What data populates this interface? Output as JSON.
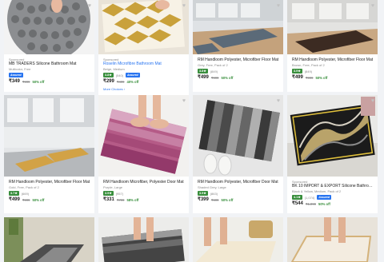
{
  "colors": {
    "accent": "#2874f0",
    "rating": "#388e3c",
    "background": "#f1f3f6"
  },
  "icons": {
    "wishlist": "heart-icon",
    "assured": "flipkart-assured-badge"
  },
  "products": [
    {
      "sponsored": "Sponsored",
      "title": "MB TRADERS Silicone Bathroom Mat",
      "variant": "Multicolor, Free",
      "rating": "",
      "count": "",
      "assured": "Assured",
      "price": "₹349",
      "mrp": "₹999",
      "off": "50% off",
      "more": ""
    },
    {
      "sponsored": "Sponsored",
      "title": "Roselin Microfibre Bathroom Mat",
      "variant": "Beige, Medium",
      "rating": "3.8★",
      "count": "(540)",
      "assured": "Assured",
      "price": "₹299",
      "mrp": "₹499",
      "off": "40% off",
      "more": "More Choices ›"
    },
    {
      "sponsored": "",
      "title": "RM Handloom Polyester, Microfiber Floor Mat",
      "variant": "Grey, Free, Pack of 2",
      "rating": "3.8★",
      "count": "(849)",
      "assured": "",
      "price": "₹499",
      "mrp": "₹999",
      "off": "50% off",
      "more": ""
    },
    {
      "sponsored": "",
      "title": "RM Handloom Polyester, Microfiber Floor Mat",
      "variant": "Brown, Free, Pack of 2",
      "rating": "3.9★",
      "count": "(849)",
      "assured": "",
      "price": "₹499",
      "mrp": "₹999",
      "off": "50% off",
      "more": ""
    },
    {
      "sponsored": "",
      "title": "RM Handloom Polyester, Microfiber Floor Mat",
      "variant": "Gold, Free, Pack of 2",
      "rating": "3.7★",
      "count": "(669)",
      "assured": "",
      "price": "₹499",
      "mrp": "₹999",
      "off": "50% off",
      "more": ""
    },
    {
      "sponsored": "",
      "title": "RM Handloom Microfiber, Polyester Door Mat",
      "variant": "Purple, Large",
      "rating": "3.9★",
      "count": "(957)",
      "assured": "",
      "price": "₹331",
      "mrp": "₹799",
      "off": "58% off",
      "more": ""
    },
    {
      "sponsored": "",
      "title": "RM Handloom Polyester, Microfiber Door Mat",
      "variant": "Shaded Grey, Large",
      "rating": "3.9★",
      "count": "(863)",
      "assured": "",
      "price": "₹399",
      "mrp": "₹699",
      "off": "50% off",
      "more": ""
    },
    {
      "sponsored": "Sponsored",
      "title": "BK 10 IMPORT & EXPORT Silicone Bathroom Mat",
      "variant": "Black & Yellow, Medium, Pack of 2",
      "rating": "4.1★",
      "count": "(1,074)",
      "assured": "Assured",
      "price": "₹544",
      "mrp": "₹1,099",
      "off": "50% off",
      "more": ""
    }
  ]
}
